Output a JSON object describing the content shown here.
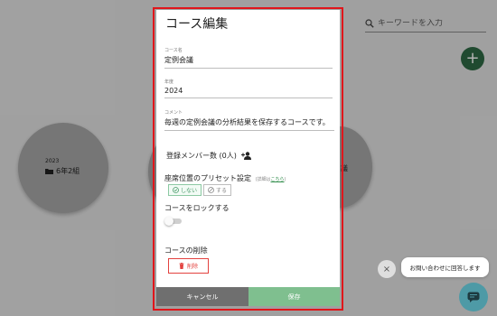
{
  "search": {
    "placeholder": "キーワードを入力",
    "icon": "search-icon"
  },
  "fab_add": {
    "label": "+"
  },
  "background_courses": [
    {
      "year": "2023",
      "name": "6年2組"
    },
    {
      "partial_text": "議"
    }
  ],
  "modal": {
    "title": "コース編集",
    "course_name": {
      "label": "コース名",
      "value": "定例会議"
    },
    "year": {
      "label": "年度",
      "value": "2024"
    },
    "comment": {
      "label": "コメント",
      "value": "毎週の定例会議の分析結果を保存するコースです。"
    },
    "members_label": "登録メンバー数 (0人)",
    "preset": {
      "label": "座席位置のプリセット設定",
      "detail_prefix": "(詳細は",
      "detail_link": "こちら",
      "detail_suffix": ")",
      "options": [
        "しない",
        "する"
      ],
      "selected": "しない"
    },
    "lock": {
      "label": "コースをロックする",
      "enabled": false
    },
    "delete": {
      "label": "コースの削除",
      "button": "削除"
    },
    "cancel_button": "キャンセル",
    "save_button": "保存"
  },
  "chat": {
    "close": "×",
    "bubble": "お問い合わせに回答します"
  },
  "colors": {
    "accent_green": "#7fbf8f",
    "fab_green": "#2f6b45",
    "danger": "#e3423f",
    "highlight_frame": "#e0161b",
    "chat": "#4e9aa6"
  }
}
